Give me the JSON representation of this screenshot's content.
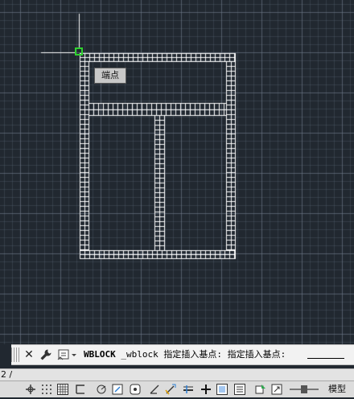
{
  "viewport": {
    "background": "#212830",
    "osnap_tooltip": "端点",
    "snap_color": "#2fd12f"
  },
  "command_line": {
    "close_glyph": "✕",
    "command_name": "WBLOCK",
    "text": " _wblock 指定插入基点: 指定插入基点:"
  },
  "layout_tabs": {
    "partial_label": "2 /"
  },
  "status_bar": {
    "buttons": [
      "coordinate-icon",
      "grid-icon",
      "snap-icon",
      "ortho-icon",
      "polar-icon",
      "osnap-icon",
      "otrack-icon",
      "ucs-icon",
      "dynamic-input-icon",
      "lineweight-icon",
      "transparency-icon",
      "quick-properties-icon",
      "selection-cycling-icon"
    ],
    "model_label": "模型"
  }
}
